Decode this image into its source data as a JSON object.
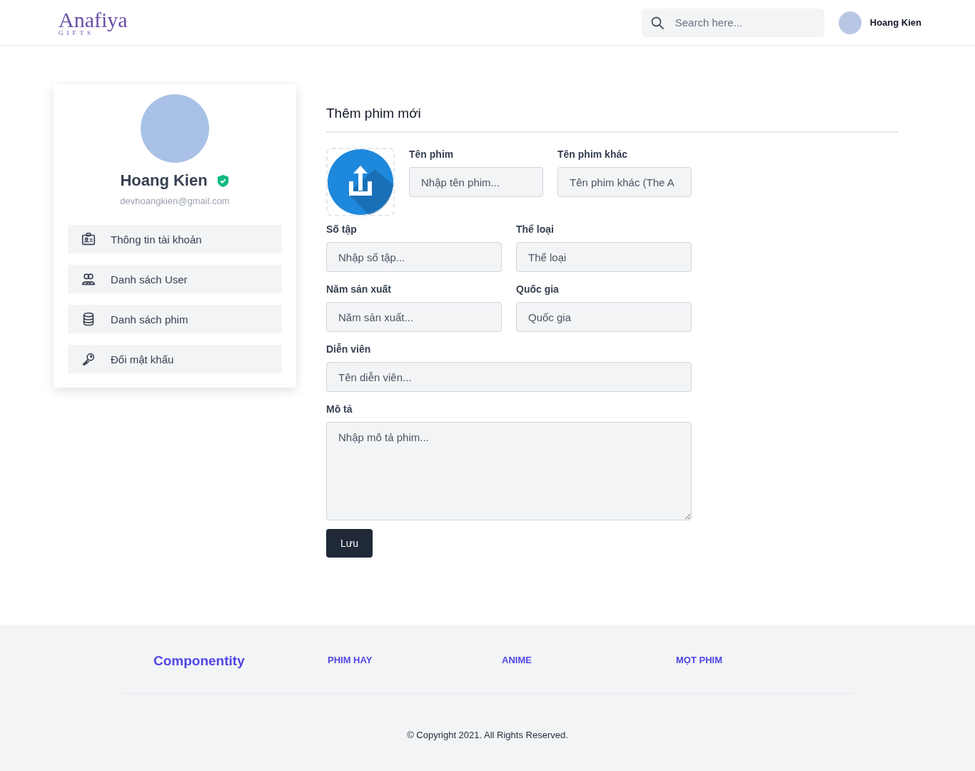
{
  "header": {
    "logo": {
      "name": "Anafiya",
      "tagline": "GIFTS"
    },
    "search": {
      "placeholder": "Search here..."
    },
    "user": {
      "name": "Hoang Kien"
    }
  },
  "profile": {
    "name": "Hoang Kien",
    "verified": true,
    "email": "devhoangkien@gmail.com"
  },
  "menu": [
    {
      "label": "Thông tin tài khoản",
      "kind": "id-card"
    },
    {
      "label": "Danh sách User",
      "kind": "users"
    },
    {
      "label": "Danh sách phim",
      "kind": "database"
    },
    {
      "label": "Đổi mật khẩu",
      "kind": "key"
    }
  ],
  "form": {
    "title": "Thêm phim mới",
    "top_fields": [
      {
        "label": "Tên phim",
        "placeholder": "Nhập tên phim..."
      },
      {
        "label": "Tên phim khác",
        "placeholder": "Tên phim khác (The A"
      }
    ],
    "fields": [
      {
        "label": "Số tập",
        "placeholder": "Nhập số tập...",
        "kind": "half"
      },
      {
        "label": "Thể loại",
        "placeholder": "Thể loại",
        "kind": "half"
      },
      {
        "label": "Năm sản xuất",
        "placeholder": "Năm sản xuất...",
        "kind": "half"
      },
      {
        "label": "Quốc gia",
        "placeholder": "Quốc gia",
        "kind": "half"
      },
      {
        "label": "Diễn viên",
        "placeholder": "Tên diễn viên...",
        "kind": "full"
      },
      {
        "label": "Mô tả",
        "placeholder": "Nhập mô tả phim...",
        "kind": "textarea"
      }
    ],
    "save_button": "Lưu"
  },
  "footer": {
    "brand": "Componentity",
    "links": [
      "PHIM HAY",
      "ANIME",
      "MỌT PHIM"
    ],
    "copyright": "© Copyright 2021. All Rights Reserved."
  }
}
